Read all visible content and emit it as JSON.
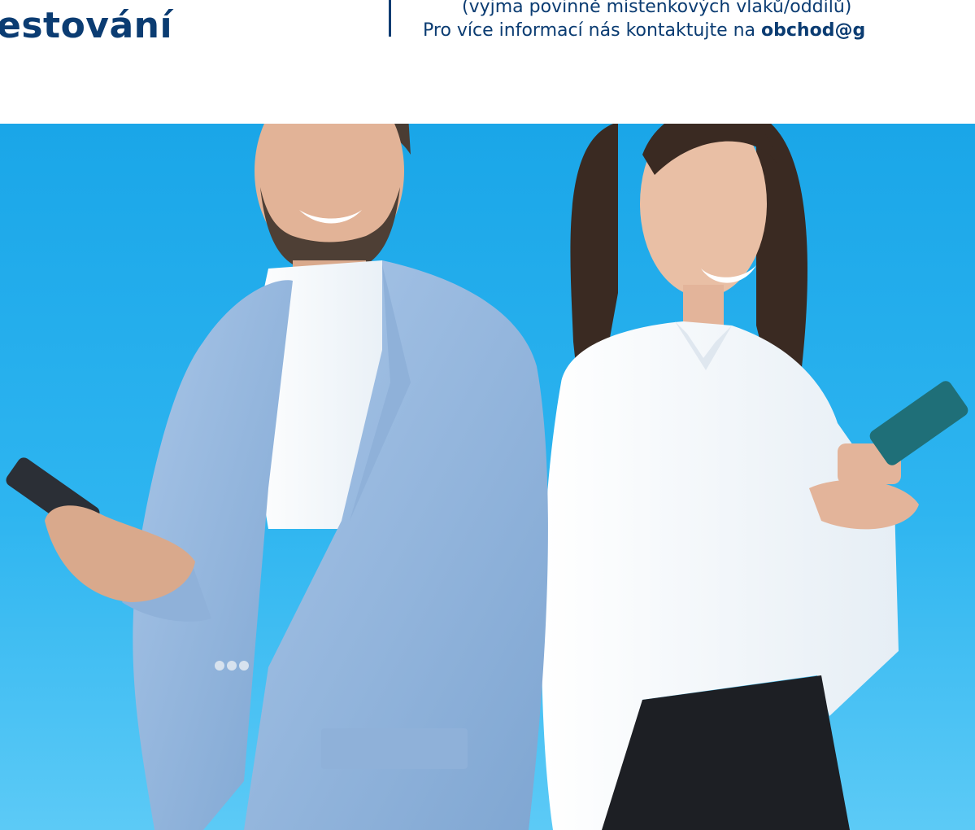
{
  "header": {
    "headline": "estování",
    "info_line1": "(vyjma povinně místenkových vlaků/oddílů)",
    "info_line2_prefix": "Pro více informací nás kontaktujte na ",
    "info_email": "obchod@g"
  },
  "colors": {
    "brand_navy": "#0b3c72",
    "sky_blue": "#1aa6e8",
    "background": "#ffffff"
  },
  "photo": {
    "subject": "man-and-woman-with-smartphones",
    "icon_names": [
      "phone-icon"
    ]
  }
}
